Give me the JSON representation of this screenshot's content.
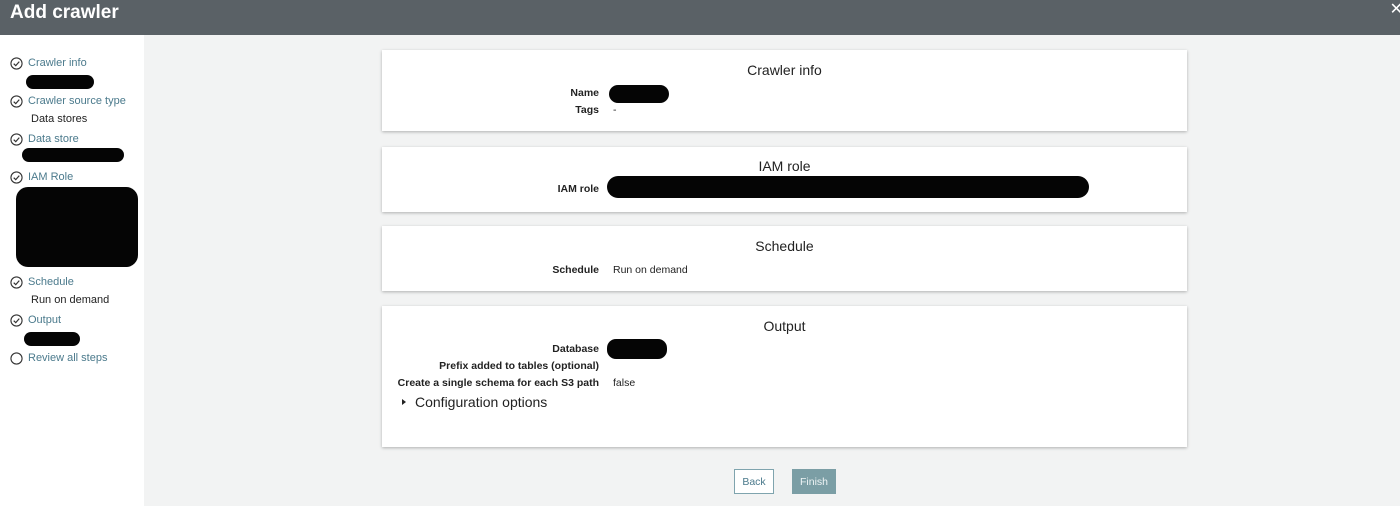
{
  "header": {
    "title": "Add crawler",
    "close_glyph": "✕"
  },
  "sidebar": {
    "steps": [
      {
        "label": "Crawler info",
        "status": "complete",
        "icon": "check-circle-icon"
      },
      {
        "label": "Crawler source type",
        "status": "complete",
        "icon": "check-circle-icon",
        "value": "Data stores"
      },
      {
        "label": "Data store",
        "status": "complete",
        "icon": "check-circle-icon"
      },
      {
        "label": "IAM Role",
        "status": "complete",
        "icon": "check-circle-icon"
      },
      {
        "label": "Schedule",
        "status": "complete",
        "icon": "check-circle-icon",
        "value": "Run on demand"
      },
      {
        "label": "Output",
        "status": "complete",
        "icon": "check-circle-icon"
      },
      {
        "label": "Review all steps",
        "status": "current",
        "icon": "empty-circle-icon"
      }
    ]
  },
  "sections": {
    "crawler_info": {
      "title": "Crawler info",
      "name_label": "Name",
      "tags_label": "Tags",
      "tags_value": "-"
    },
    "iam_role": {
      "title": "IAM role",
      "role_label": "IAM role"
    },
    "schedule": {
      "title": "Schedule",
      "schedule_label": "Schedule",
      "schedule_value": "Run on demand"
    },
    "output": {
      "title": "Output",
      "database_label": "Database",
      "prefix_label": "Prefix added to tables (optional)",
      "schema_label": "Create a single schema for each S3 path",
      "schema_value": "false",
      "config_label": "Configuration options"
    }
  },
  "buttons": {
    "back": "Back",
    "finish": "Finish"
  },
  "colors": {
    "header_bg": "#5a6166",
    "link": "#4b7a8c",
    "primary_button": "#7b9ea5",
    "redaction": "#050505"
  }
}
